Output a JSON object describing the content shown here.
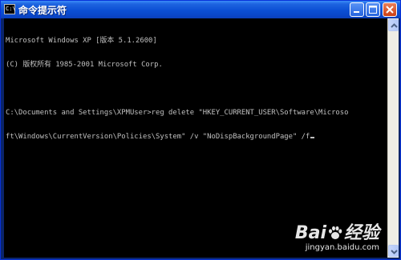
{
  "window": {
    "title": "命令提示符",
    "app_icon_text": "C:\\",
    "controls": {
      "minimize": "minimize-icon",
      "maximize": "maximize-icon",
      "close": "close-icon"
    }
  },
  "console": {
    "lines": [
      "Microsoft Windows XP [版本 5.1.2600]",
      "(C) 版权所有 1985-2001 Microsoft Corp.",
      "",
      "C:\\Documents and Settings\\XPMUser>reg delete \"HKEY_CURRENT_USER\\Software\\Microso",
      "ft\\Windows\\CurrentVersion\\Policies\\System\" /v \"NoDispBackgroundPage\" /f"
    ],
    "text_color": "#c0c0c0",
    "background": "#000000"
  },
  "watermark": {
    "logo_left": "Bai",
    "logo_right": "经验",
    "url": "jingyan.baidu.com"
  },
  "colors": {
    "title_blue": "#0b4fd4",
    "close_red": "#cc3f14",
    "scroll_track": "#eeede5"
  }
}
